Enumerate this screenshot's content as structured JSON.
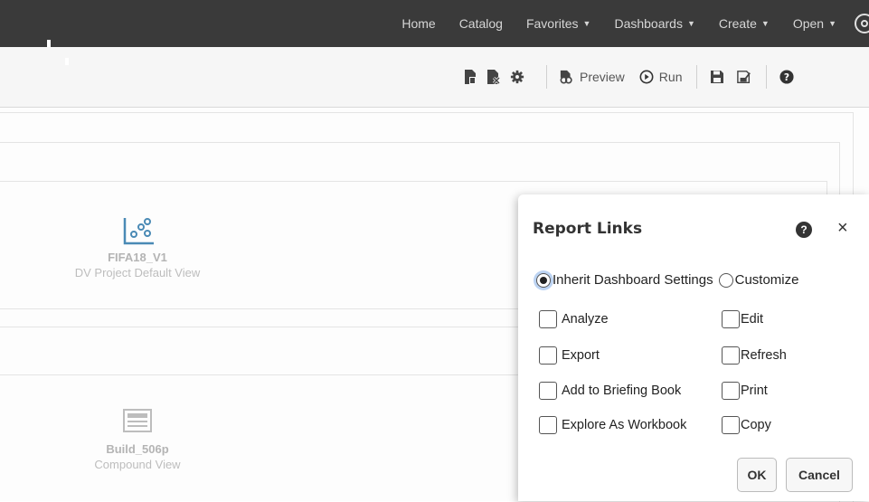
{
  "nav": {
    "items": [
      {
        "label": "Home",
        "dropdown": false
      },
      {
        "label": "Catalog",
        "dropdown": false
      },
      {
        "label": "Favorites",
        "dropdown": true
      },
      {
        "label": "Dashboards",
        "dropdown": true
      },
      {
        "label": "Create",
        "dropdown": true
      },
      {
        "label": "Open",
        "dropdown": true
      }
    ],
    "caret": "▼"
  },
  "toolbar": {
    "preview_label": "Preview",
    "run_label": "Run"
  },
  "views": [
    {
      "name": "FIFA18_V1",
      "type": "DV Project Default View",
      "icon": "scatter-chart-icon"
    },
    {
      "name": "Build_506p",
      "type": "Compound View",
      "icon": "compound-view-icon"
    }
  ],
  "dialog": {
    "title": "Report Links",
    "help": "?",
    "close": "×",
    "radios": [
      {
        "label": "Inherit Dashboard Settings",
        "checked": true
      },
      {
        "label": "Customize",
        "checked": false
      }
    ],
    "checkboxes": {
      "left": [
        "Analyze",
        "Export",
        "Add to Briefing Book",
        "Explore As Workbook"
      ],
      "right": [
        "Edit",
        "Refresh",
        "Print",
        "Copy"
      ]
    },
    "ok_label": "OK",
    "cancel_label": "Cancel"
  },
  "colors": {
    "topbar": "#3a3a3a",
    "toolbar": "#f6f6f6",
    "view_icon": "#4a8ab5"
  }
}
